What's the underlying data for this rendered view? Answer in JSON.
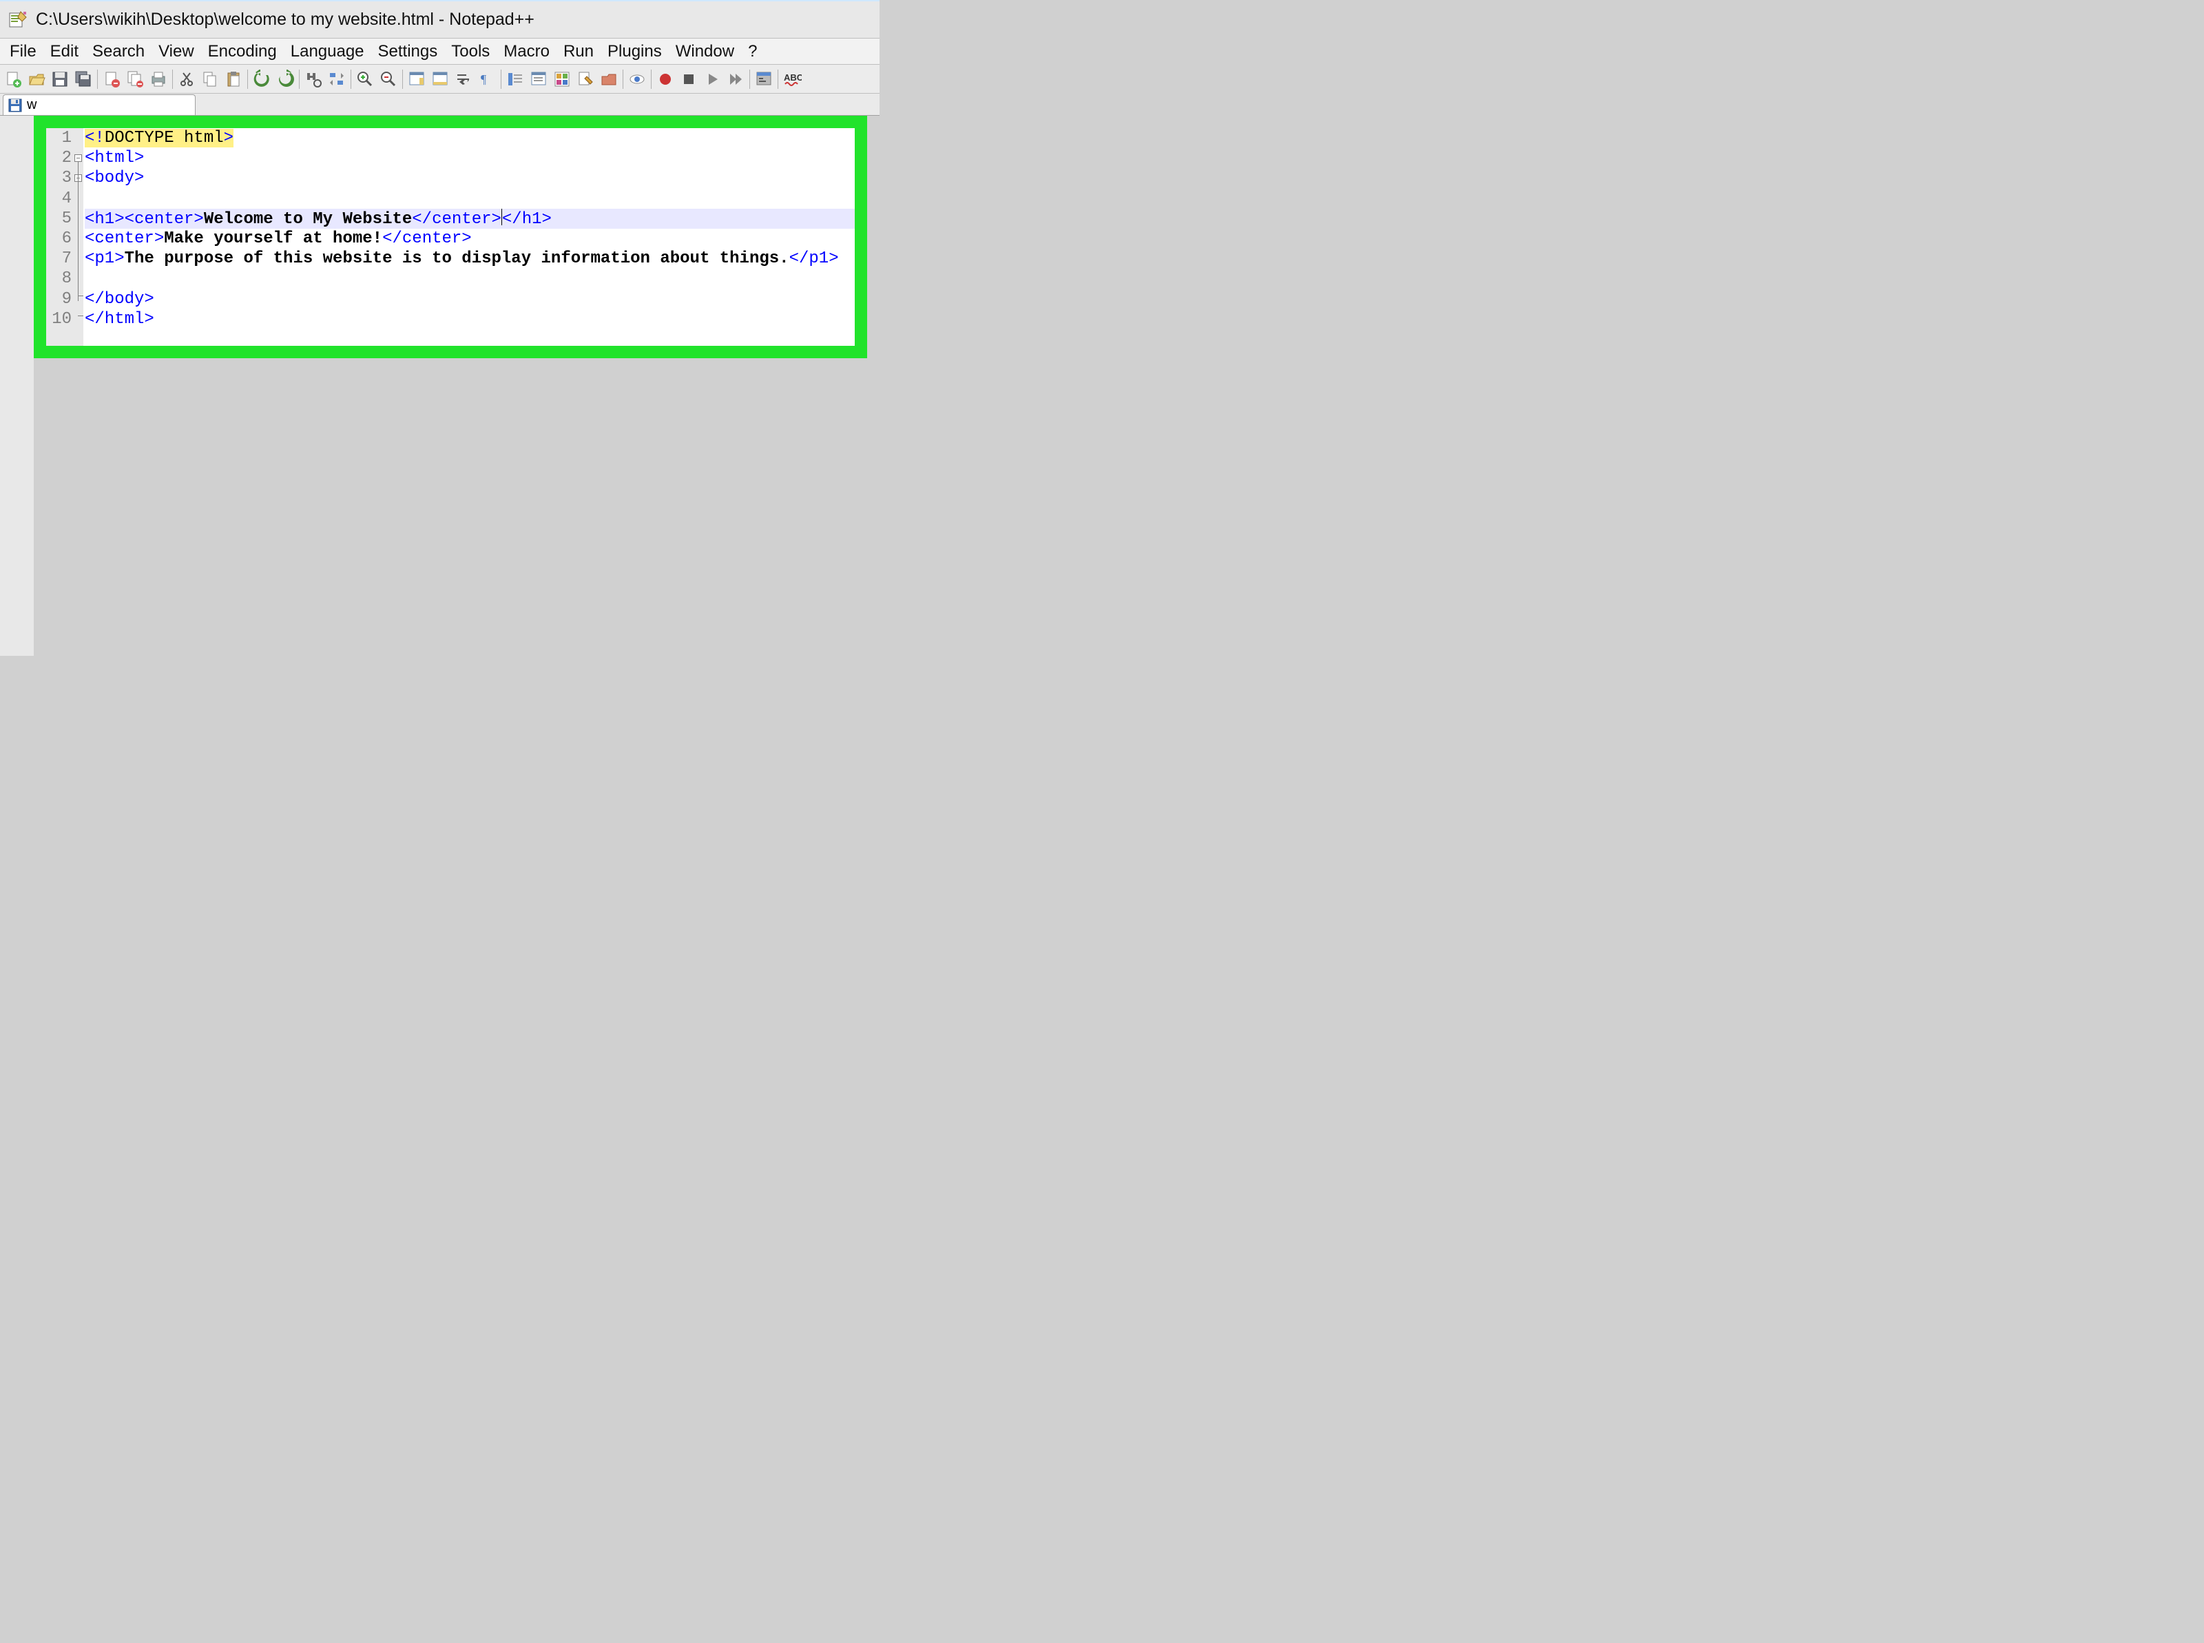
{
  "title_bar": {
    "path": "C:\\Users\\wikih\\Desktop\\welcome to my website.html - Notepad++"
  },
  "menu": {
    "items": [
      "File",
      "Edit",
      "Search",
      "View",
      "Encoding",
      "Language",
      "Settings",
      "Tools",
      "Macro",
      "Run",
      "Plugins",
      "Window",
      "?"
    ]
  },
  "toolbar": {
    "buttons": [
      "new-file",
      "open-file",
      "save",
      "save-all",
      "|",
      "close",
      "close-all",
      "print",
      "|",
      "cut",
      "copy",
      "paste",
      "|",
      "undo",
      "redo",
      "|",
      "find",
      "replace",
      "|",
      "zoom-in",
      "zoom-out",
      "|",
      "sync-v",
      "sync-h",
      "word-wrap",
      "show-all",
      "|",
      "indent-guide",
      "outdent",
      "lang-preview",
      "user-define",
      "folder",
      "|",
      "monitor",
      "|",
      "record",
      "stop",
      "play",
      "play-multi",
      "|",
      "run-script",
      "|",
      "spell-check"
    ]
  },
  "tab": {
    "label": "w"
  },
  "editor": {
    "line_numbers": [
      "1",
      "2",
      "3",
      "4",
      "5",
      "6",
      "7",
      "8",
      "9",
      "10"
    ],
    "lines": [
      {
        "tokens": [
          {
            "t": "<!",
            "c": "doctype-bg tag"
          },
          {
            "t": "DOCTYPE html",
            "c": "doctype-bg"
          },
          {
            "t": ">",
            "c": "doctype-bg tag"
          }
        ]
      },
      {
        "tokens": [
          {
            "t": "<html>",
            "c": "tag"
          }
        ]
      },
      {
        "tokens": [
          {
            "t": "<body>",
            "c": "tag"
          }
        ]
      },
      {
        "tokens": []
      },
      {
        "hl": true,
        "tokens": [
          {
            "t": "<h1><center>",
            "c": "tag"
          },
          {
            "t": "Welcome to My Website",
            "c": "bold"
          },
          {
            "t": "</center>",
            "c": "tag"
          },
          {
            "caret": true
          },
          {
            "t": "</h1>",
            "c": "tag"
          }
        ]
      },
      {
        "tokens": [
          {
            "t": "<center>",
            "c": "tag"
          },
          {
            "t": "Make yourself at home!",
            "c": "bold"
          },
          {
            "t": "</center>",
            "c": "tag"
          }
        ]
      },
      {
        "tokens": [
          {
            "t": "<p1>",
            "c": "tag"
          },
          {
            "t": "The purpose of this website is to display information about things.",
            "c": "bold"
          },
          {
            "t": "</p1>",
            "c": "tag"
          }
        ]
      },
      {
        "tokens": []
      },
      {
        "tokens": [
          {
            "t": "</body>",
            "c": "tag"
          }
        ]
      },
      {
        "tokens": [
          {
            "t": "</html>",
            "c": "tag"
          }
        ]
      }
    ]
  }
}
